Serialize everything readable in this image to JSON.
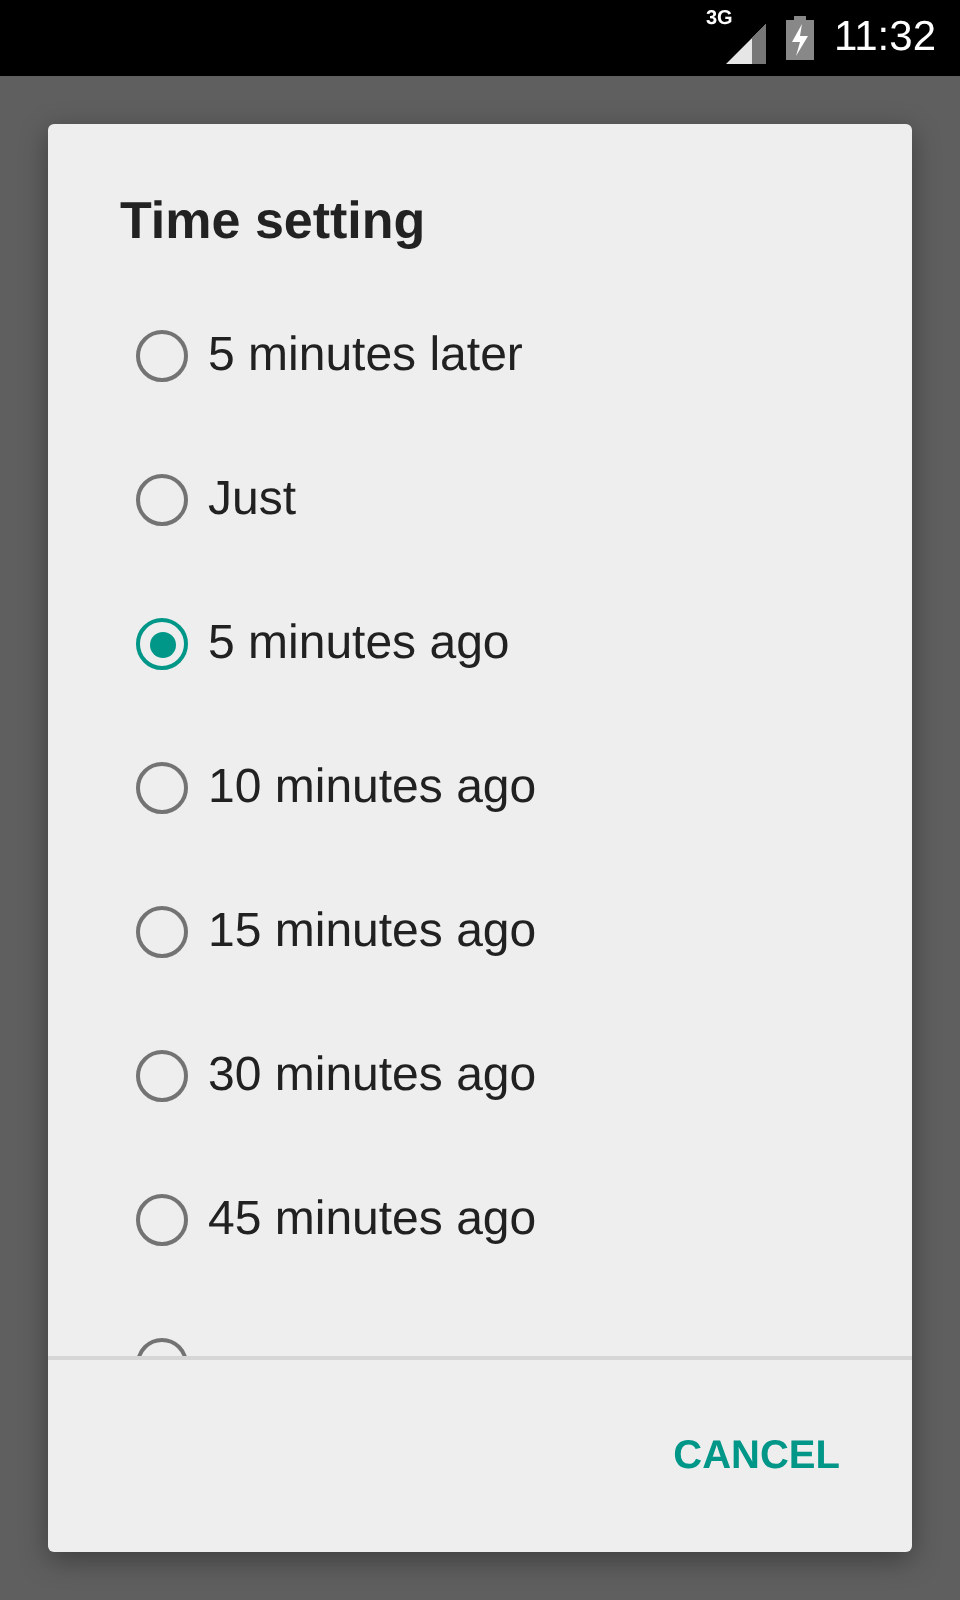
{
  "status_bar": {
    "network": "3G",
    "time": "11:32"
  },
  "dialog": {
    "title": "Time setting",
    "options": [
      {
        "label": "5 minutes later",
        "selected": false
      },
      {
        "label": "Just",
        "selected": false
      },
      {
        "label": "5 minutes ago",
        "selected": true
      },
      {
        "label": "10 minutes ago",
        "selected": false
      },
      {
        "label": "15 minutes ago",
        "selected": false
      },
      {
        "label": "30 minutes ago",
        "selected": false
      },
      {
        "label": "45 minutes ago",
        "selected": false
      },
      {
        "selected": false
      }
    ],
    "buttons": [
      "CANCEL"
    ]
  }
}
